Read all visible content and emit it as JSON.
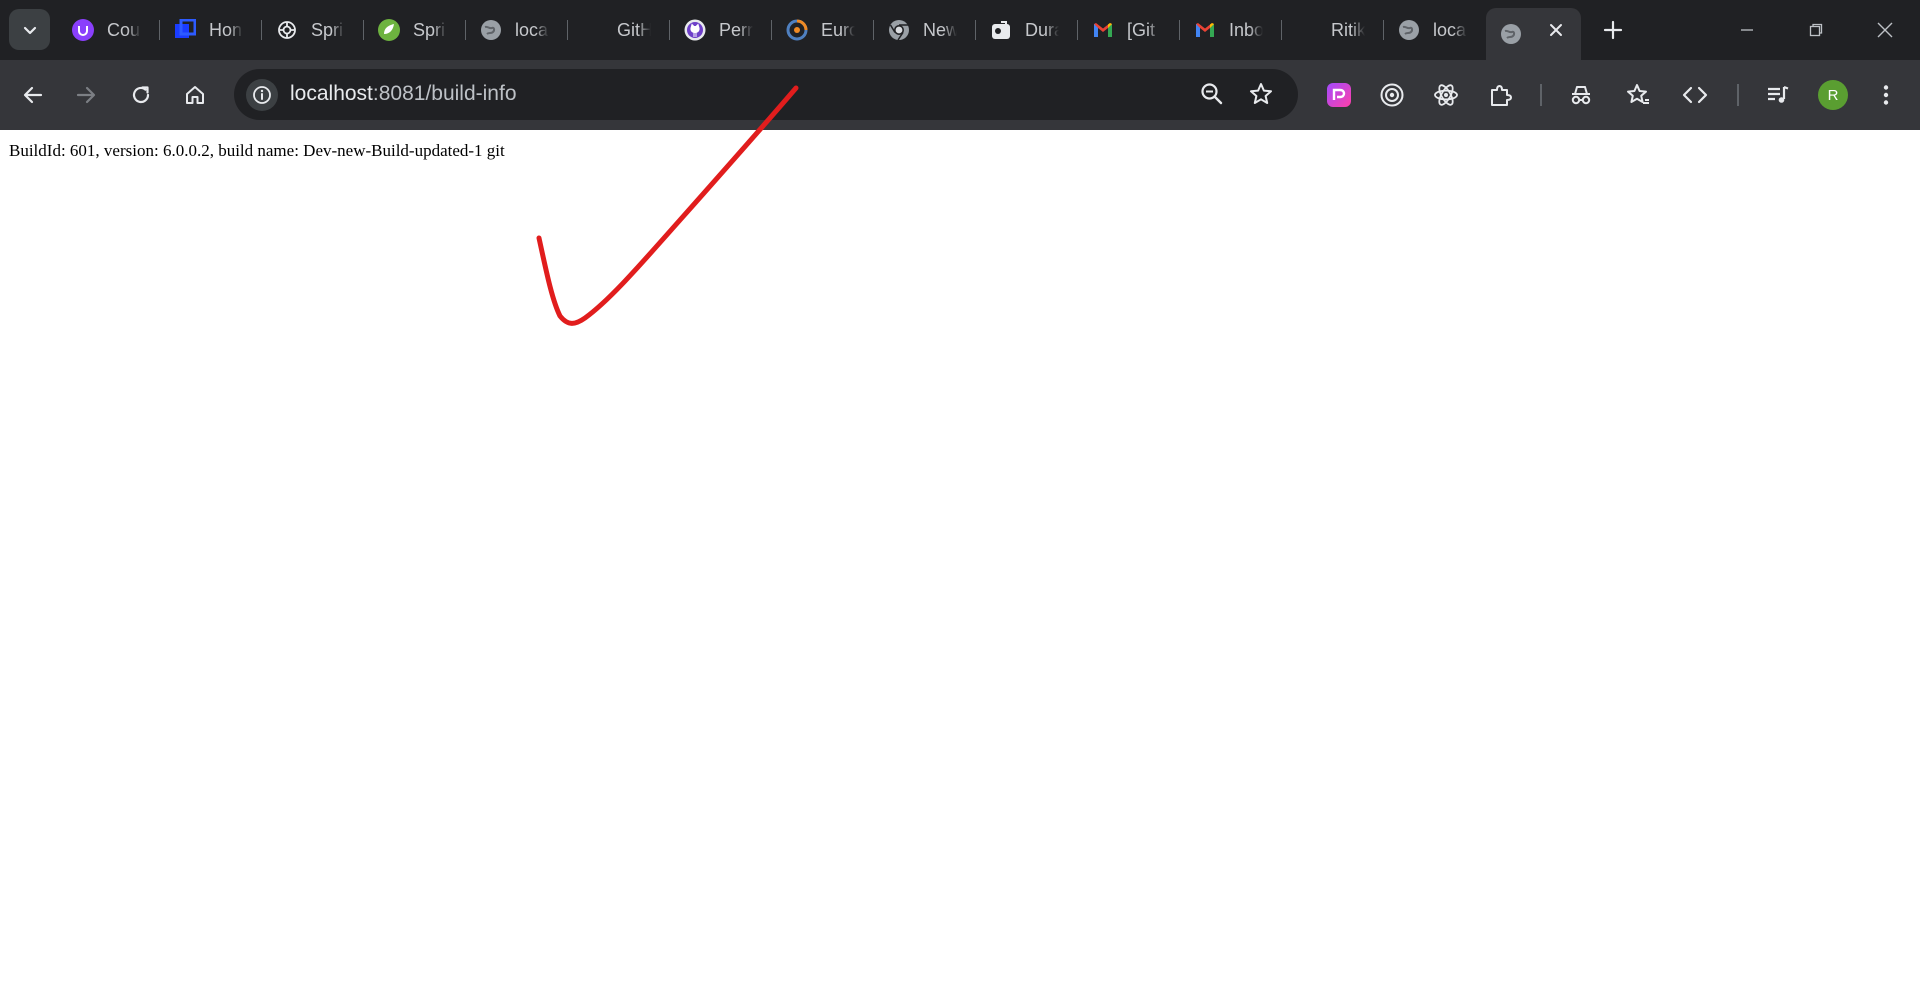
{
  "browser": {
    "tabs": [
      {
        "title": "Cou",
        "icon": "udemy-icon"
      },
      {
        "title": "Hon",
        "icon": "cube-icon"
      },
      {
        "title": "Spri",
        "icon": "chatgpt-icon"
      },
      {
        "title": "Spri",
        "icon": "spring-icon"
      },
      {
        "title": "loca",
        "icon": "globe-icon"
      },
      {
        "title": "GitH",
        "icon": "none"
      },
      {
        "title": "Perr",
        "icon": "github-icon"
      },
      {
        "title": "Eurc",
        "icon": "eureka-icon"
      },
      {
        "title": "New",
        "icon": "chrome-icon"
      },
      {
        "title": "Dura",
        "icon": "duration-icon"
      },
      {
        "title": "[Git",
        "icon": "gmail-icon"
      },
      {
        "title": "Inbo",
        "icon": "gmail-icon"
      },
      {
        "title": "Ritik",
        "icon": "none"
      },
      {
        "title": "loca",
        "icon": "globe-icon"
      }
    ],
    "active_tab": {
      "title": "",
      "icon": "globe-icon"
    },
    "address": {
      "host": "localhost",
      "path": ":8081/build-info"
    },
    "profile_initial": "R",
    "colors": {
      "frame": "#202124",
      "toolbar": "#35363a",
      "omnibox": "#202124",
      "avatar": "#5a9e31",
      "annotation": "#e11d1d"
    }
  },
  "page": {
    "build_info_text": "BuildId: 601, version: 6.0.0.2, build name: Dev-new-Build-updated-1 git"
  },
  "annotation": {
    "shape": "checkmark",
    "color": "#e11d1d"
  }
}
